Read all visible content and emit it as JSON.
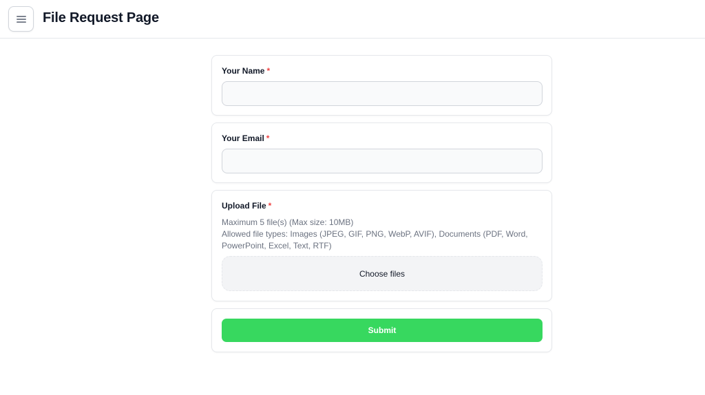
{
  "header": {
    "title": "File Request Page",
    "menu_icon": "hamburger-menu-icon"
  },
  "form": {
    "name": {
      "label": "Your Name",
      "required_mark": "*",
      "value": ""
    },
    "email": {
      "label": "Your Email",
      "required_mark": "*",
      "value": ""
    },
    "upload": {
      "label": "Upload File",
      "required_mark": "*",
      "limit_text": "Maximum 5 file(s) (Max size: 10MB)",
      "types_text": "Allowed file types: Images (JPEG, GIF, PNG, WebP, AVIF), Documents (PDF, Word, PowerPoint, Excel, Text, RTF)",
      "dropzone_label": "Choose files"
    },
    "submit_label": "Submit"
  },
  "colors": {
    "accent": "#37d85f",
    "required": "#ef4444",
    "muted_text": "#6b7280"
  }
}
